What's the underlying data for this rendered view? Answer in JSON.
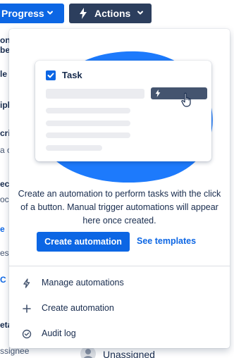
{
  "toolbar": {
    "progress_label": "Progress",
    "actions_label": "Actions"
  },
  "background": {
    "fragments": [
      "on",
      "be",
      "le s",
      "iple",
      "cri",
      "a c",
      "ec",
      "ocl",
      "e",
      "es",
      "C",
      "eta"
    ],
    "assignee_label": "ssignee",
    "assignee_value": "Unassigned"
  },
  "actions_menu": {
    "illustration": {
      "card_title": "Task"
    },
    "description": "Create an automation to perform tasks with the click of a button. Manual trigger automations will appear here once created.",
    "create_button_label": "Create automation",
    "see_templates_label": "See templates",
    "items": [
      {
        "label": "Manage automations",
        "icon": "bolt-icon"
      },
      {
        "label": "Create automation",
        "icon": "plus-icon"
      },
      {
        "label": "Audit log",
        "icon": "check-circle-icon"
      }
    ]
  },
  "colors": {
    "primary": "#0C66E4",
    "dark_button": "#2C3E5D",
    "blob": "#1D7AFC"
  }
}
